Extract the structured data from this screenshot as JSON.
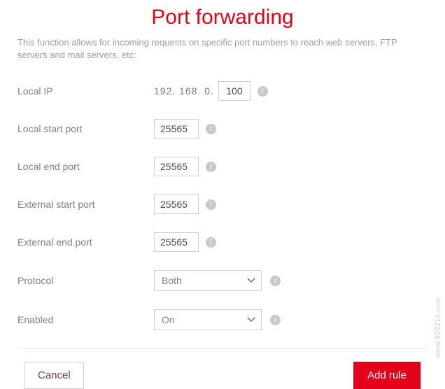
{
  "title": "Port forwarding",
  "description": "This function allows for incoming requests on specific port numbers to reach web servers, FTP servers and mail servers, etc:",
  "ip": {
    "label": "Local IP",
    "prefix": "192.  168.  0. ",
    "value": "100"
  },
  "fields": {
    "local_start": {
      "label": "Local start port",
      "value": "25565"
    },
    "local_end": {
      "label": "Local end port",
      "value": "25565"
    },
    "external_start": {
      "label": "External start port",
      "value": "25565"
    },
    "external_end": {
      "label": "External end port",
      "value": "25565"
    }
  },
  "protocol": {
    "label": "Protocol",
    "selected": "Both"
  },
  "enabled": {
    "label": "Enabled",
    "selected": "On"
  },
  "buttons": {
    "cancel": "Cancel",
    "add": "Add rule"
  },
  "info_glyph": "i",
  "watermark": "www.999214.com"
}
